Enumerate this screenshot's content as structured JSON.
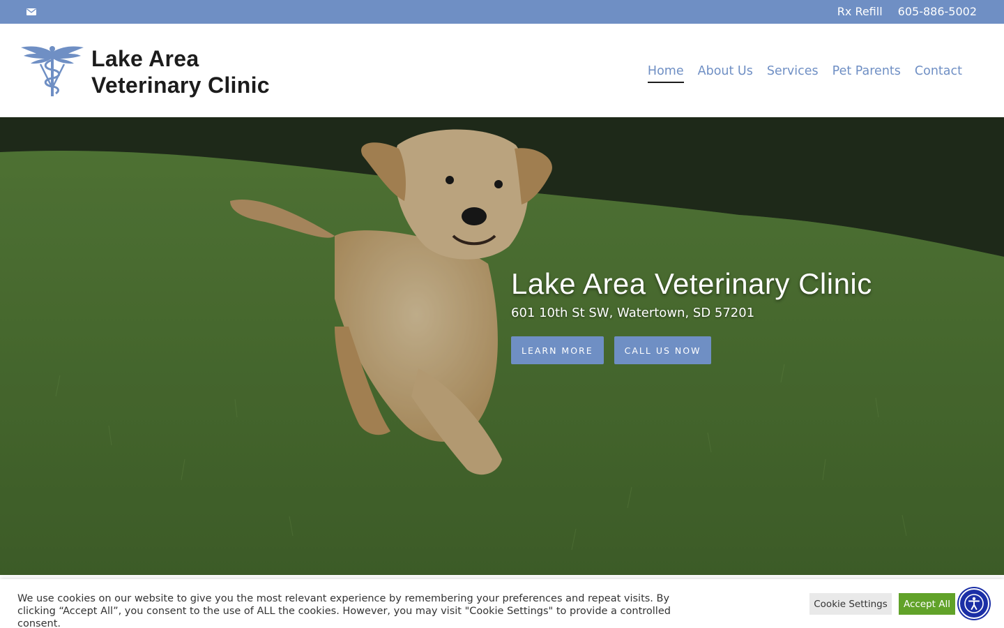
{
  "topbar": {
    "mail_icon": "envelope-icon",
    "rx_refill": "Rx Refill",
    "phone": "605-886-5002",
    "background": "#6f8fc4"
  },
  "header": {
    "logo_icon": "caduceus-logo-icon",
    "brand_line1": "Lake Area",
    "brand_line2": "Veterinary Clinic",
    "nav": [
      {
        "label": "Home",
        "active": true
      },
      {
        "label": "About Us",
        "active": false
      },
      {
        "label": "Services",
        "active": false
      },
      {
        "label": "Pet Parents",
        "active": false
      },
      {
        "label": "Contact",
        "active": false
      }
    ],
    "accent": "#6f8fc4"
  },
  "hero": {
    "title": "Lake Area Veterinary Clinic",
    "address": "601 10th St SW, Watertown, SD 57201",
    "learn_more": "LEARN MORE",
    "call_us": "CALL US NOW"
  },
  "cookie": {
    "text": "We use cookies on our website to give you the most relevant experience by remembering your preferences and repeat visits. By clicking “Accept All”, you consent to the use of ALL the cookies. However, you may visit \"Cookie Settings\" to provide a controlled consent.",
    "settings_label": "Cookie Settings",
    "accept_label": "Accept All",
    "accept_color": "#61a229"
  },
  "accessibility": {
    "icon": "accessibility-icon",
    "color": "#1b2fa6"
  }
}
